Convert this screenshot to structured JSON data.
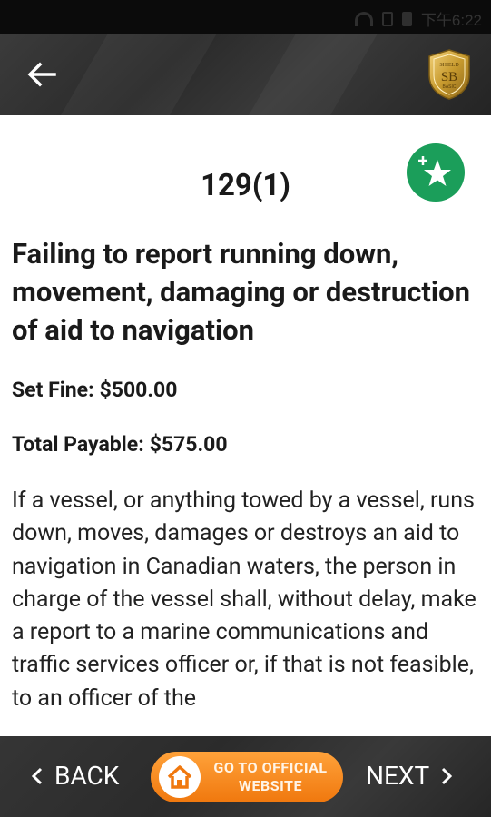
{
  "status_bar": {
    "time": "下午6:22",
    "icons": [
      "wifi-icon",
      "sim-icon",
      "battery-icon"
    ]
  },
  "header": {
    "back_icon": "arrow-left-icon",
    "logo": {
      "top_text": "SHIELD",
      "initials": "SB",
      "bottom_text": "BASIC"
    }
  },
  "offense": {
    "section": "129(1)",
    "title": "Failing to report running down, movement, damaging or destruction of aid to navigation",
    "set_fine_label": "Set Fine:",
    "set_fine_value": "$500.00",
    "total_payable_label": "Total Payable:",
    "total_payable_value": "$575.00",
    "description": "If a vessel, or anything towed by a vessel, runs down, moves, damages or destroys an aid to navigation in Canadian waters, the person in charge of the vessel shall, without delay, make a report to a marine communications and traffic services officer or, if that is not feasible, to an officer of the"
  },
  "favorite": {
    "icon": "add-star-icon"
  },
  "bottom_nav": {
    "back_label": "BACK",
    "official_line1": "GO TO OFFICIAL",
    "official_line2": "WEBSITE",
    "next_label": "NEXT"
  },
  "colors": {
    "header_bg": "#333333",
    "favorite_green": "#1b9e5a",
    "official_orange": "#f58a1f",
    "logo_gold": "#c9a03a"
  }
}
